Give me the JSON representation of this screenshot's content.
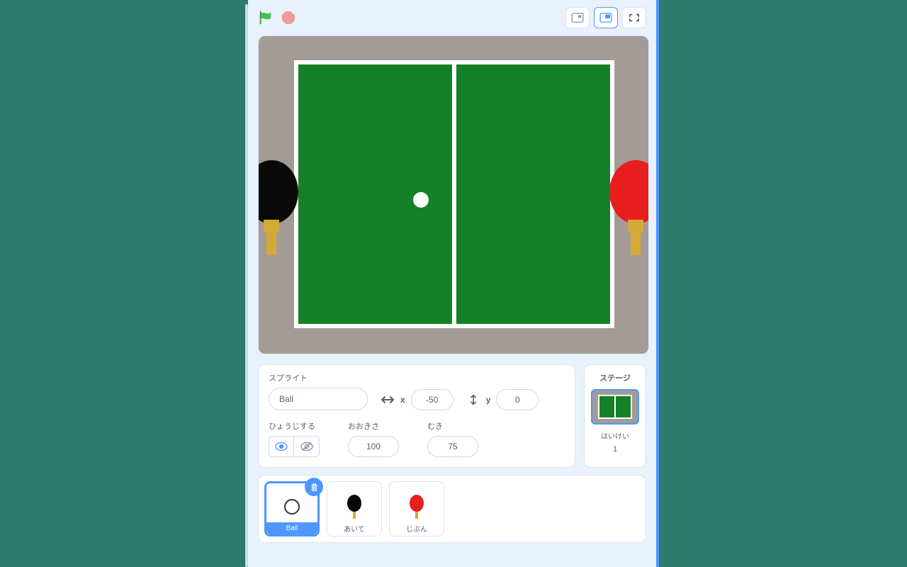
{
  "header": {
    "flag_title": "Go",
    "stop_title": "Stop"
  },
  "sprite_info": {
    "sprite_label": "スプライト",
    "name": "Ball",
    "x_label": "x",
    "x_value": "-50",
    "y_label": "y",
    "y_value": "0",
    "show_label": "ひょうじする",
    "size_label": "おおきさ",
    "size_value": "100",
    "direction_label": "むき",
    "direction_value": "75"
  },
  "stage_panel": {
    "title": "ステージ",
    "backdrop_label": "はいけい",
    "backdrop_count": "1"
  },
  "sprites": [
    {
      "name": "Ball"
    },
    {
      "name": "あいて"
    },
    {
      "name": "じぶん"
    }
  ]
}
